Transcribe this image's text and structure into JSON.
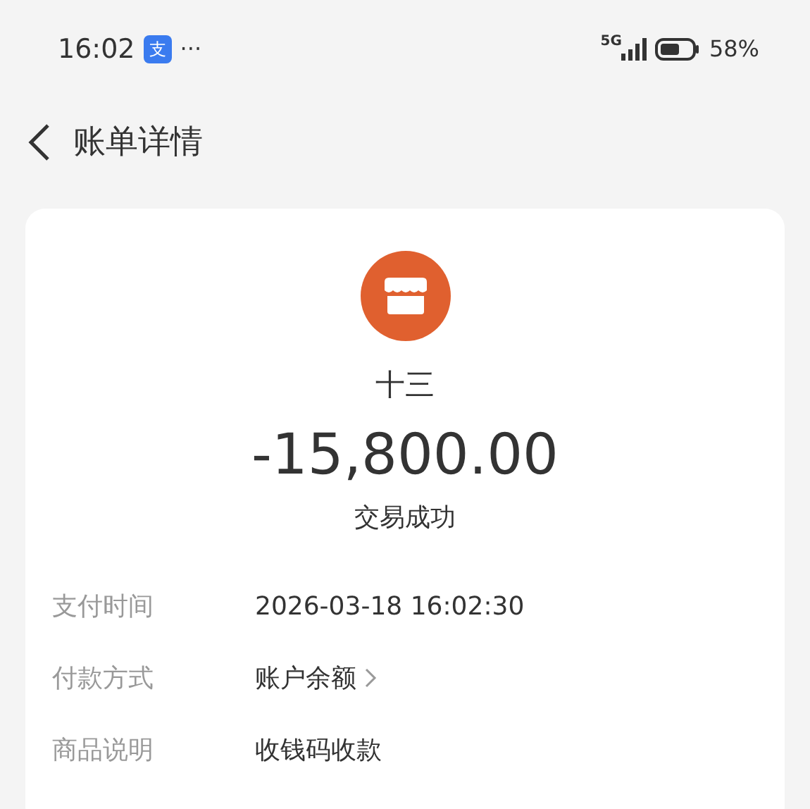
{
  "status_bar": {
    "time": "16:02",
    "app_badge": "支",
    "more": "···",
    "network": "5G",
    "battery": "58%"
  },
  "header": {
    "title": "账单详情"
  },
  "bill": {
    "merchant": "十三",
    "amount": "-15,800.00",
    "status": "交易成功",
    "details": [
      {
        "label": "支付时间",
        "value": "2026-03-18 16:02:30",
        "link": false
      },
      {
        "label": "付款方式",
        "value": "账户余额",
        "link": true
      },
      {
        "label": "商品说明",
        "value": "收钱码收款",
        "link": false
      }
    ]
  }
}
